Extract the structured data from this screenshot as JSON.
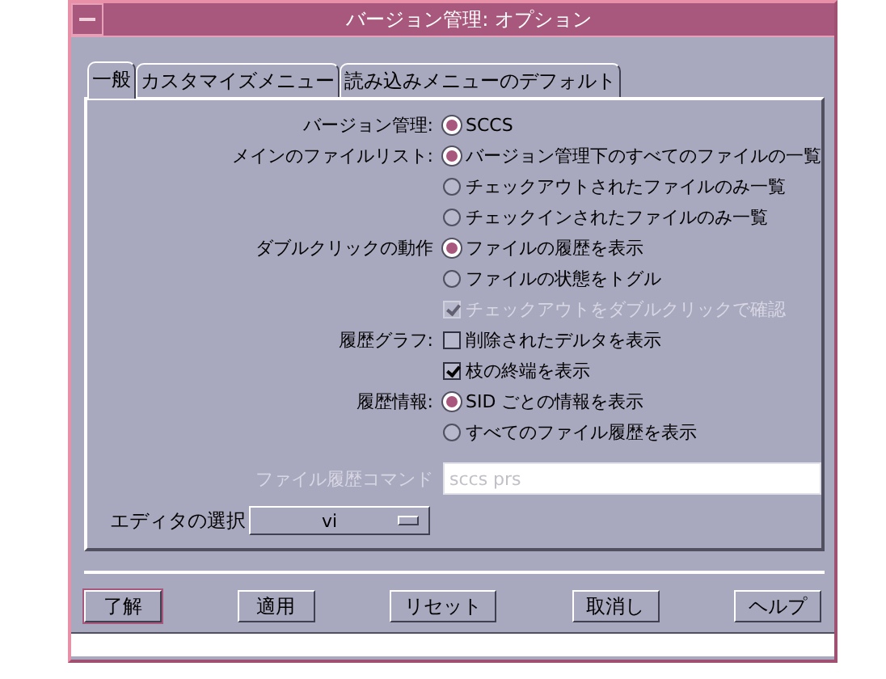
{
  "window": {
    "title": "バージョン管理: オプション"
  },
  "tabs": [
    {
      "label": "一般",
      "selected": true
    },
    {
      "label": "カスタマイズメニュー",
      "selected": false
    },
    {
      "label": "読み込みメニューのデフォルト",
      "selected": false
    }
  ],
  "settings": [
    {
      "label": "バージョン管理:",
      "options": [
        {
          "kind": "radio",
          "label": "SCCS",
          "selected": true,
          "disabled": false
        }
      ]
    },
    {
      "label": "メインのファイルリスト:",
      "options": [
        {
          "kind": "radio",
          "label": "バージョン管理下のすべてのファイルの一覧",
          "selected": true,
          "disabled": false
        },
        {
          "kind": "radio",
          "label": "チェックアウトされたファイルのみ一覧",
          "selected": false,
          "disabled": false
        },
        {
          "kind": "radio",
          "label": "チェックインされたファイルのみ一覧",
          "selected": false,
          "disabled": false
        }
      ]
    },
    {
      "label": "ダブルクリックの動作",
      "options": [
        {
          "kind": "radio",
          "label": "ファイルの履歴を表示",
          "selected": true,
          "disabled": false
        },
        {
          "kind": "radio",
          "label": "ファイルの状態をトグル",
          "selected": false,
          "disabled": false
        },
        {
          "kind": "checkbox",
          "label": "チェックアウトをダブルクリックで確認",
          "checked": true,
          "disabled": true
        }
      ]
    },
    {
      "label": "履歴グラフ:",
      "options": [
        {
          "kind": "checkbox",
          "label": "削除されたデルタを表示",
          "checked": false,
          "disabled": false
        },
        {
          "kind": "checkbox",
          "label": "枝の終端を表示",
          "checked": true,
          "disabled": false
        }
      ]
    },
    {
      "label": "履歴情報:",
      "options": [
        {
          "kind": "radio",
          "label": "SID ごとの情報を表示",
          "selected": true,
          "disabled": false
        },
        {
          "kind": "radio",
          "label": "すべてのファイル履歴を表示",
          "selected": false,
          "disabled": false
        }
      ]
    }
  ],
  "command_field": {
    "label": "ファイル履歴コマンド",
    "value": "sccs prs",
    "disabled": true
  },
  "editor": {
    "label": "エディタの選択",
    "value": "vi"
  },
  "buttons": [
    {
      "label": "了解",
      "default": true
    },
    {
      "label": "適用",
      "default": false
    },
    {
      "label": "リセット",
      "default": false
    },
    {
      "label": "取消し",
      "default": false
    },
    {
      "label": "ヘルプ",
      "default": false
    }
  ]
}
